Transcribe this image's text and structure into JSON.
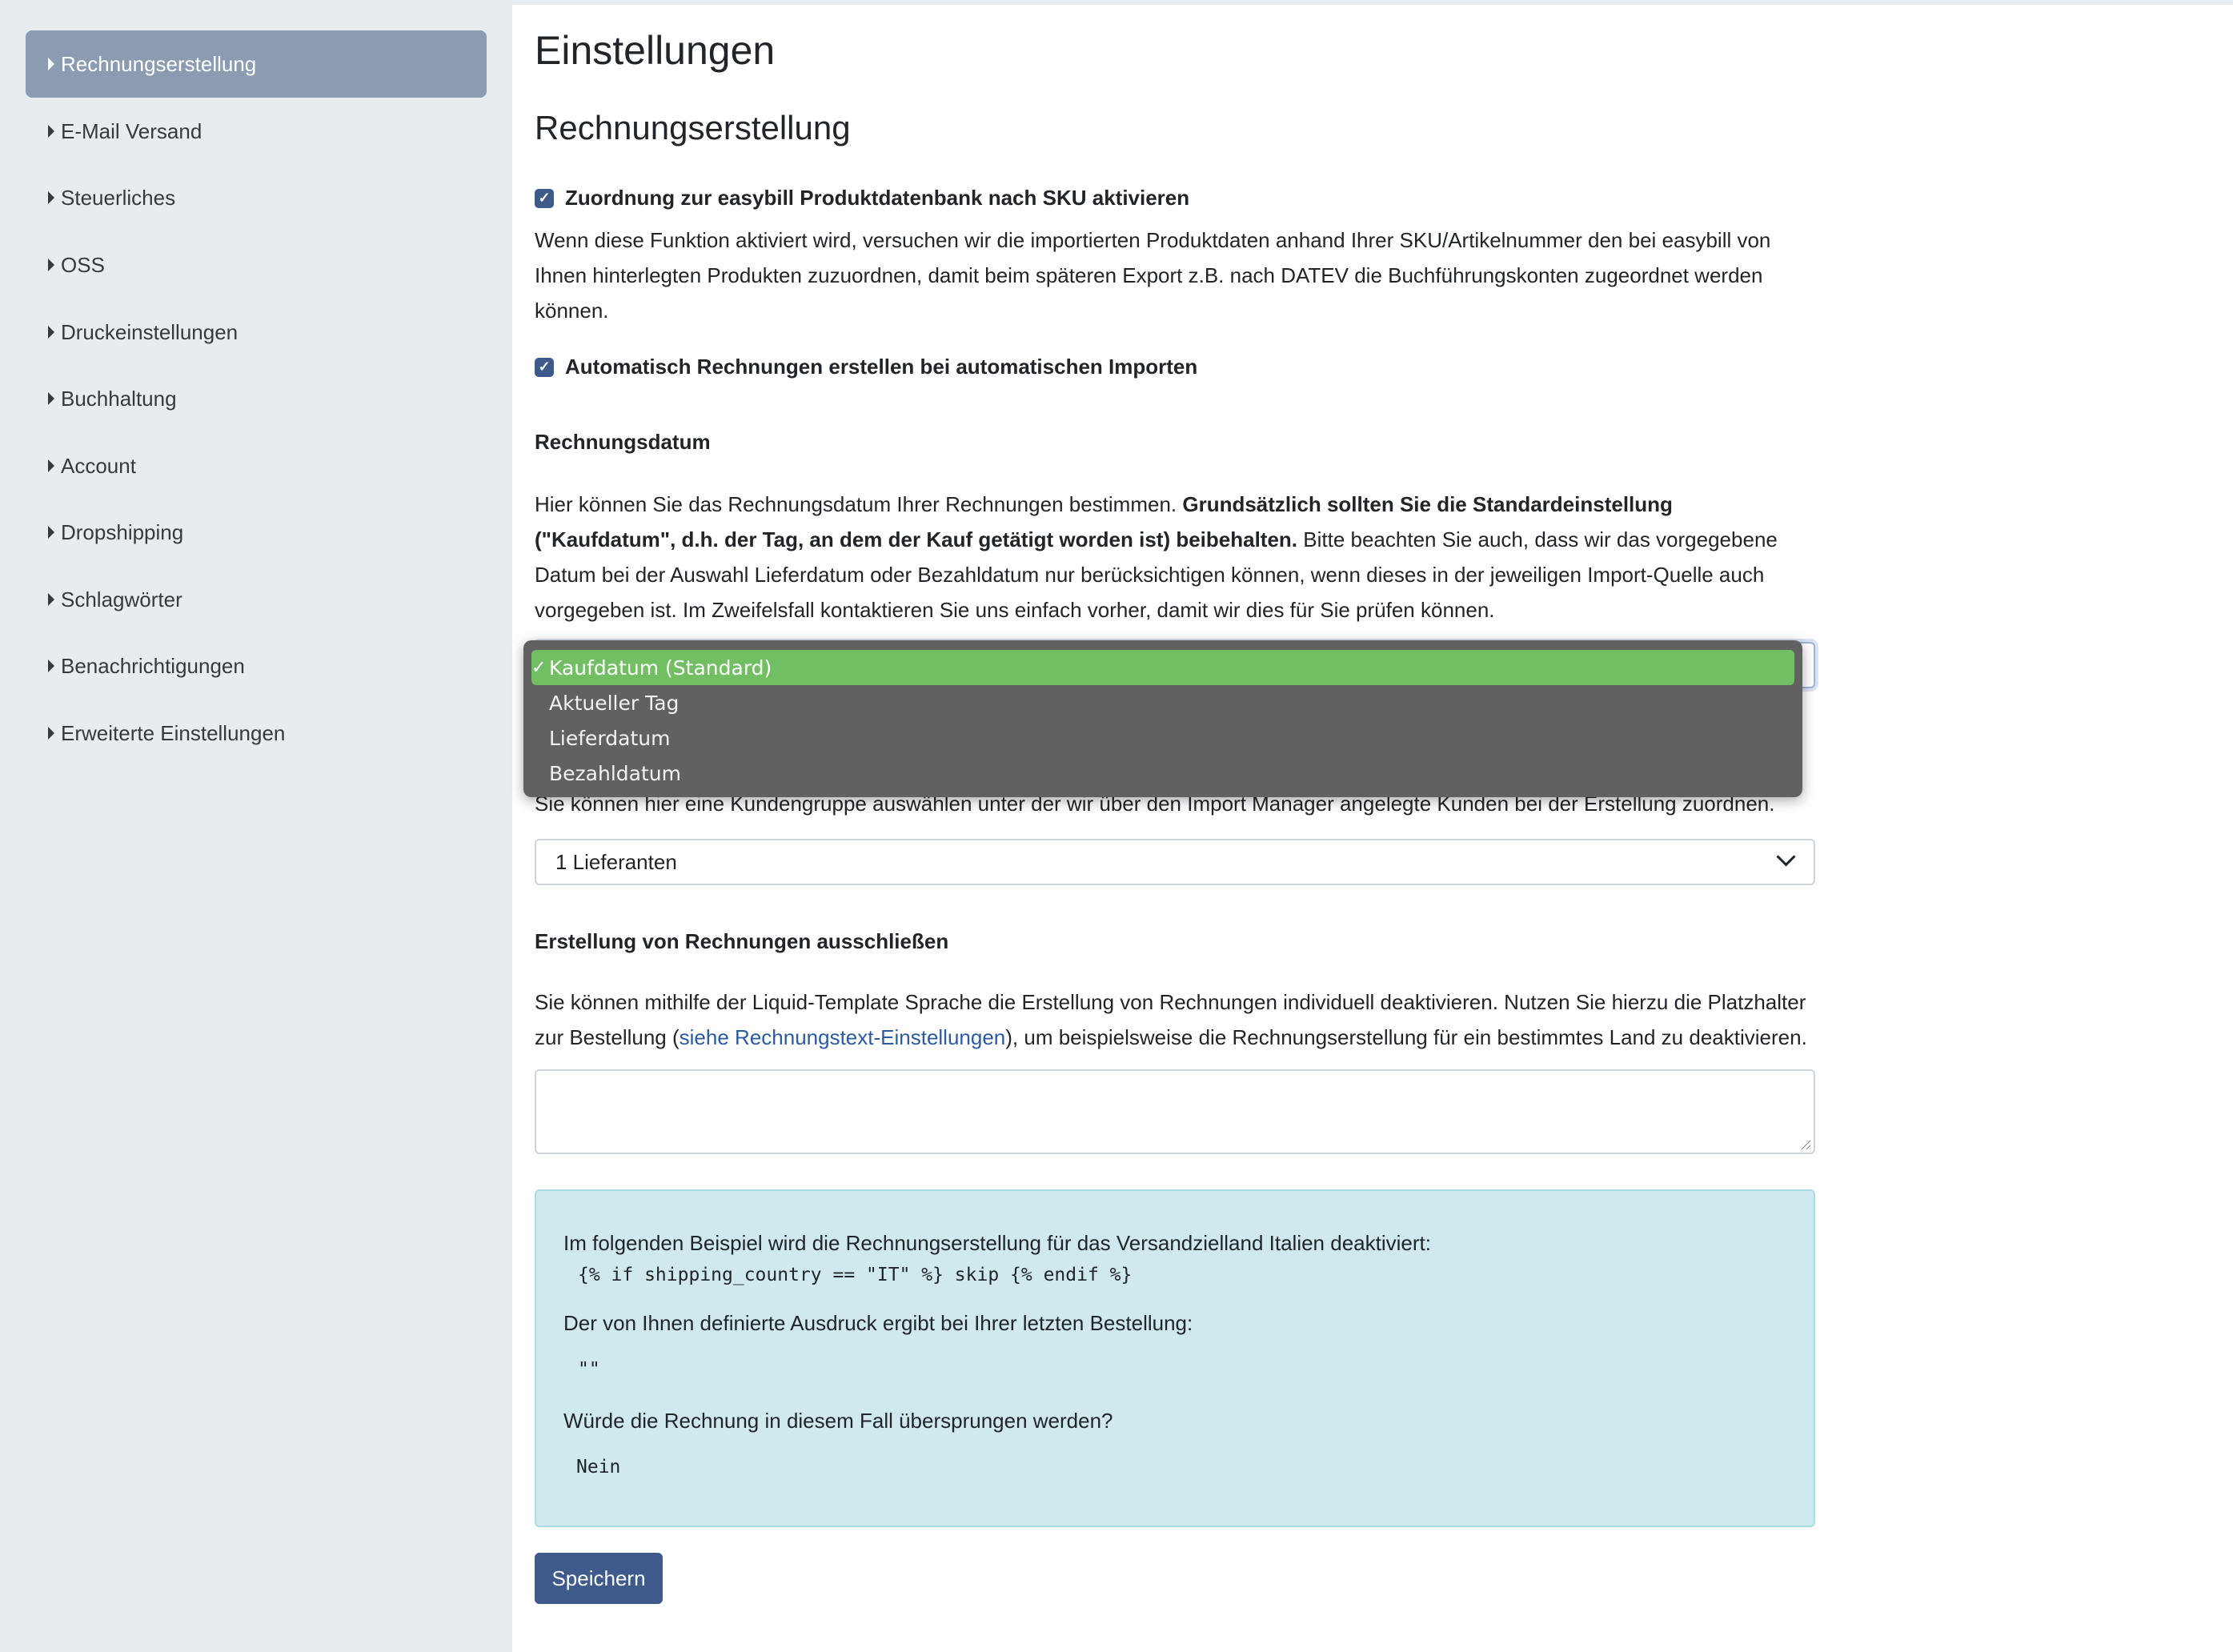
{
  "sidebar": {
    "items": [
      {
        "label": "Rechnungserstellung"
      },
      {
        "label": "E-Mail Versand"
      },
      {
        "label": "Steuerliches"
      },
      {
        "label": "OSS"
      },
      {
        "label": "Druckeinstellungen"
      },
      {
        "label": "Buchhaltung"
      },
      {
        "label": "Account"
      },
      {
        "label": "Dropshipping"
      },
      {
        "label": "Schlagwörter"
      },
      {
        "label": "Benachrichtigungen"
      },
      {
        "label": "Erweiterte Einstellungen"
      }
    ],
    "active_index": 0
  },
  "page": {
    "title": "Einstellungen",
    "section_title": "Rechnungserstellung"
  },
  "sku": {
    "checkbox_label": "Zuordnung zur easybill Produktdatenbank nach SKU aktivieren",
    "checked": true,
    "description": "Wenn diese Funktion aktiviert wird, versuchen wir die importierten Produktdaten anhand Ihrer SKU/Artikelnummer den bei easybill von Ihnen hinterlegten Produkten zuzuordnen, damit beim späteren Export z.B. nach DATEV die Buchführungskonten zugeordnet werden können."
  },
  "auto_invoice": {
    "checkbox_label": "Automatisch Rechnungen erstellen bei automatischen Importen",
    "checked": true
  },
  "invoice_date": {
    "heading": "Rechnungsdatum",
    "text_normal_1": "Hier können Sie das Rechnungsdatum Ihrer Rechnungen bestimmen. ",
    "text_bold": "Grundsätzlich sollten Sie die Standardeinstellung (\"Kaufdatum\", d.h. der Tag, an dem der Kauf getätigt worden ist) beibehalten.",
    "text_normal_2": " Bitte beachten Sie auch, dass wir das vorgegebene Datum bei der Auswahl Lieferdatum oder Bezahldatum nur berücksichtigen können, wenn dieses in der jeweiligen Import-Quelle auch vorgegeben ist. Im Zweifelsfall kontaktieren Sie uns einfach vorher, damit wir dies für Sie prüfen können.",
    "options": [
      "Kaufdatum (Standard)",
      "Aktueller Tag",
      "Lieferdatum",
      "Bezahldatum"
    ],
    "selected": "Kaufdatum (Standard)",
    "check_glyph": "✓"
  },
  "customer_group": {
    "description": "Sie können hier eine Kundengruppe auswählen unter der wir über den Import Manager angelegte Kunden bei der Erstellung zuordnen.",
    "selected": "1 Lieferanten"
  },
  "exclude": {
    "heading": "Erstellung von Rechnungen ausschließen",
    "text_before_link": "Sie können mithilfe der Liquid-Template Sprache die Erstellung von Rechnungen individuell deaktivieren. Nutzen Sie hierzu die Platzhalter zur Bestellung (",
    "link_text": "siehe Rechnungstext-Einstellungen",
    "text_after_link": "), um beispielsweise die Rechnungserstellung für ein bestimmtes Land zu deaktivieren.",
    "textarea_value": ""
  },
  "info": {
    "example_intro": "Im folgenden Beispiel wird die Rechnungserstellung für das Versandzielland Italien deaktiviert:",
    "example_code": "{% if shipping_country == \"IT\" %} skip {% endif %}",
    "result_label": "Der von Ihnen definierte Ausdruck ergibt bei Ihrer letzten Bestellung:",
    "result_value": "\"\"",
    "skip_question": "Würde die Rechnung in diesem Fall übersprungen werden?",
    "skip_answer": "Nein"
  },
  "actions": {
    "save_label": "Speichern"
  },
  "colors": {
    "primary": "#3d5a8a",
    "sidebar_active": "#8a9bb2",
    "dropdown_selected": "#72bf63",
    "info_bg": "#cfe9ee"
  }
}
